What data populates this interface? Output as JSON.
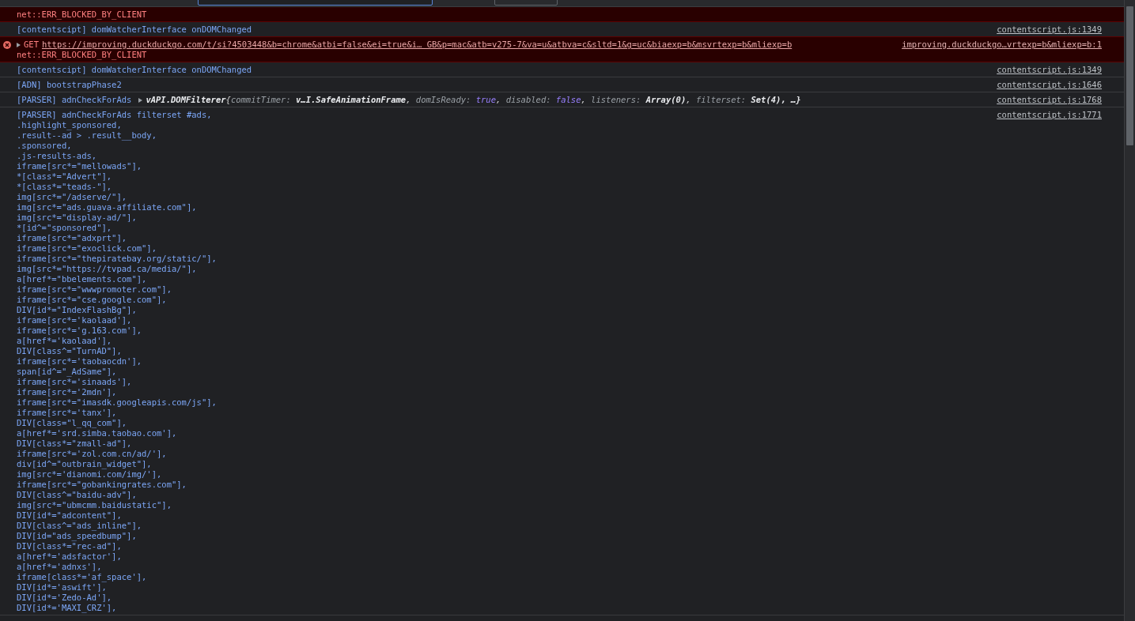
{
  "messages": [
    {
      "kind": "error",
      "lines": [
        "net::ERR_BLOCKED_BY_CLIENT"
      ]
    },
    {
      "kind": "log",
      "lines": [
        "[contentscipt] domWatcherInterface onDOMChanged"
      ],
      "source": "contentscript.js:1349"
    },
    {
      "kind": "error",
      "expanded": false,
      "request": {
        "method": "GET",
        "url": "https://improving.duckduckgo.com/t/si?4503448&b=chrome&atbi=false&ei=true&i… GB&p=mac&atb=v275-7&va=u&atbva=c&sltd=1&g=uc&biaexp=b&msvrtexp=b&mliexp=b"
      },
      "lines": [
        "net::ERR_BLOCKED_BY_CLIENT"
      ],
      "source": "improving.duckduckgo…vrtexp=b&mliexp=b:1"
    },
    {
      "kind": "log",
      "lines": [
        "[contentscipt] domWatcherInterface onDOMChanged"
      ],
      "source": "contentscript.js:1349"
    },
    {
      "kind": "log",
      "lines": [
        "[ADN] bootstrapPhase2"
      ],
      "source": "contentscript.js:1646"
    },
    {
      "kind": "log",
      "lines": [
        "[PARSER] adnCheckForAds"
      ],
      "object": {
        "expanded": false,
        "name": "vAPI.DOMFilterer",
        "parts": [
          {
            "text": "{",
            "kind": "punct"
          },
          {
            "text": "commitTimer: ",
            "kind": "key"
          },
          {
            "text": "v…I.SafeAnimationFrame",
            "kind": "value"
          },
          {
            "text": ", ",
            "kind": "punct"
          },
          {
            "text": "domIsReady: ",
            "kind": "key"
          },
          {
            "text": "true",
            "kind": "bool"
          },
          {
            "text": ", ",
            "kind": "punct"
          },
          {
            "text": "disabled: ",
            "kind": "key"
          },
          {
            "text": "false",
            "kind": "bool"
          },
          {
            "text": ", ",
            "kind": "punct"
          },
          {
            "text": "listeners: ",
            "kind": "key"
          },
          {
            "text": "Array(0)",
            "kind": "value"
          },
          {
            "text": ", ",
            "kind": "punct"
          },
          {
            "text": "filterset: ",
            "kind": "key"
          },
          {
            "text": "Set(4)",
            "kind": "value"
          },
          {
            "text": ", …}",
            "kind": "value"
          }
        ]
      },
      "source": "contentscript.js:1768"
    },
    {
      "kind": "log",
      "source": "contentscript.js:1771",
      "lines": [
        "[PARSER] adnCheckForAds filterset #ads,",
        ".highlight_sponsored,",
        ".result--ad > .result__body,",
        ".sponsored,",
        ".js-results-ads,",
        "iframe[src*=\"mellowads\"],",
        "*[class*=\"Advert\"],",
        "*[class*=\"teads-\"],",
        "img[src*=\"/adserve/\"],",
        "img[src*=\"ads.guava-affiliate.com\"],",
        "img[src*=\"display-ad/\"],",
        "*[id^=\"sponsored\"],",
        "iframe[src*=\"adxprt\"],",
        "iframe[src*=\"exoclick.com\"],",
        "iframe[src*=\"thepiratebay.org/static/\"],",
        "img[src*=\"https://tvpad.ca/media/\"],",
        "a[href*=\"bbelements.com\"],",
        "iframe[src*=\"wwwpromoter.com\"],",
        "iframe[src*=\"cse.google.com\"],",
        "DIV[id*=\"IndexFlashBg\"],",
        "iframe[src*='kaolaad'],",
        "iframe[src*='g.163.com'],",
        "a[href*='kaolaad'],",
        "DIV[class^=\"TurnAD\"],",
        "iframe[src*='taobaocdn'],",
        "span[id^=\"_AdSame\"],",
        "iframe[src*='sinaads'],",
        "iframe[src*='2mdn'],",
        "iframe[src*=\"imasdk.googleapis.com/js\"],",
        "iframe[src*='tanx'],",
        "DIV[class=\"l_qq_com\"],",
        "a[href*='srd.simba.taobao.com'],",
        "DIV[class*=\"zmall-ad\"],",
        "iframe[src*='zol.com.cn/ad/'],",
        "div[id^=\"outbrain_widget\"],",
        "img[src*='dianomi.com/img/'],",
        "iframe[src*=\"gobankingrates.com\"],",
        "DIV[class^=\"baidu-adv\"],",
        "img[src*=\"ubmcmm.baidustatic\"],",
        "DIV[id*=\"adcontent\"],",
        "DIV[class^=\"ads_inline\"],",
        "DIV[id=\"ads_speedbump\"],",
        "DIV[class*=\"rec-ad\"],",
        "a[href*='adsfactor'],",
        "a[href*='adnxs'],",
        "iframe[class*='af_space'],",
        "DIV[id*='aswift'],",
        "DIV[id*='Zedo-Ad'],",
        "DIV[id*='MAXI_CRZ'],"
      ]
    }
  ]
}
